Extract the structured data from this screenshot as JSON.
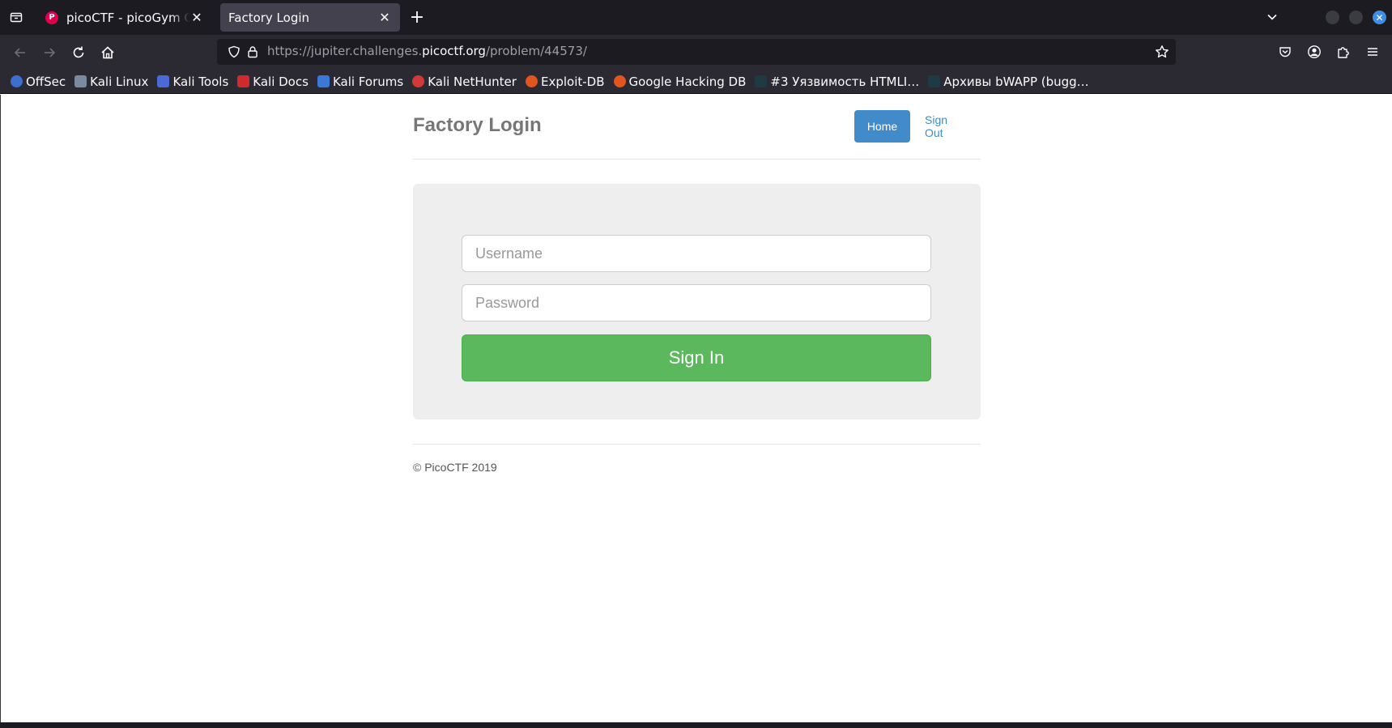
{
  "browser": {
    "tabs": [
      {
        "title": "picoCTF - picoGym Challenges",
        "active": false,
        "favicon": "picoctf-favicon"
      },
      {
        "title": "Factory Login",
        "active": true
      }
    ],
    "url": {
      "prefix": "https://jupiter.challenges.",
      "domain": "picoctf.org",
      "path": "/problem/44573/"
    },
    "bookmarks": [
      {
        "label": "OffSec",
        "color": "#3d6fd1"
      },
      {
        "label": "Kali Linux",
        "color": "#7a8aa0"
      },
      {
        "label": "Kali Tools",
        "color": "#4a6ad6"
      },
      {
        "label": "Kali Docs",
        "color": "#d22a2a"
      },
      {
        "label": "Kali Forums",
        "color": "#3b79d8"
      },
      {
        "label": "Kali NetHunter",
        "color": "#d23a3a"
      },
      {
        "label": "Exploit-DB",
        "color": "#e0561e"
      },
      {
        "label": "Google Hacking DB",
        "color": "#e0561e"
      },
      {
        "label": "#3 Уязвимость HTMLI…",
        "color": "#1e3a44"
      },
      {
        "label": "Архивы bWAPP (bugg…",
        "color": "#1e3a44"
      }
    ]
  },
  "page": {
    "brand": "Factory Login",
    "nav": {
      "home": "Home",
      "sign_out": "Sign Out"
    },
    "form": {
      "username_placeholder": "Username",
      "password_placeholder": "Password",
      "submit_label": "Sign In"
    },
    "footer": "© PicoCTF 2019"
  },
  "colors": {
    "primary": "#428bca",
    "success": "#5cb85c",
    "jumbotron": "#eeeeee"
  }
}
